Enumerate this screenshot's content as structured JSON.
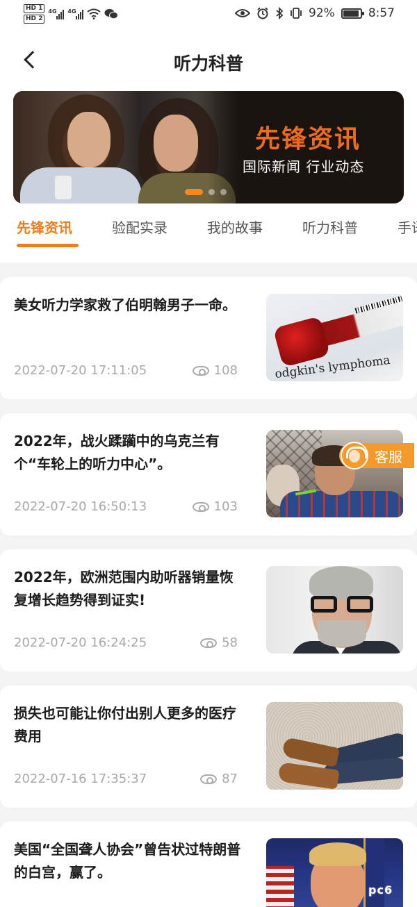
{
  "status_bar": {
    "hd1": "HD 1",
    "hd2": "HD 2",
    "net1": "4G",
    "net2": "4G",
    "battery_percent": "92%",
    "time": "8:57",
    "battery_level": 0.92
  },
  "header": {
    "title": "听力科普",
    "back_icon": "chevron-left-icon"
  },
  "banner": {
    "title": "先锋资讯",
    "subtitle": "国际新闻 行业动态",
    "slide_count": 3,
    "active_slide": 1
  },
  "tabs": [
    {
      "label": "先锋资讯",
      "active": true
    },
    {
      "label": "验配实录",
      "active": false
    },
    {
      "label": "我的故事",
      "active": false
    },
    {
      "label": "听力科普",
      "active": false
    },
    {
      "label": "手语",
      "active": false
    }
  ],
  "articles": [
    {
      "title": "美女听力学家救了伯明翰男子一命。",
      "date": "2022-07-20 17:11:05",
      "views": "108",
      "thumb_caption": "odgkin's lymphoma"
    },
    {
      "title": "2022年，战火蹂躏中的乌克兰有个“车轮上的听力中心”。",
      "date": "2022-07-20 16:50:13",
      "views": "103"
    },
    {
      "title": "2022年，欧洲范围内助听器销量恢复增长趋势得到证实!",
      "date": "2022-07-20 16:24:25",
      "views": "58"
    },
    {
      "title": "损失也可能让你付出别人更多的医疗费用",
      "date": "2022-07-16 17:35:37",
      "views": "87"
    },
    {
      "title": "美国“全国聋人协会”曾告状过特朗普的白宫，赢了。",
      "date": "",
      "views": ""
    }
  ],
  "support_button": {
    "label": "客服"
  },
  "watermark": "pc6",
  "colors": {
    "accent": "#ee7d1c",
    "background": "#f4f4f4",
    "card": "#ffffff",
    "meta_text": "#a9a9a9"
  }
}
